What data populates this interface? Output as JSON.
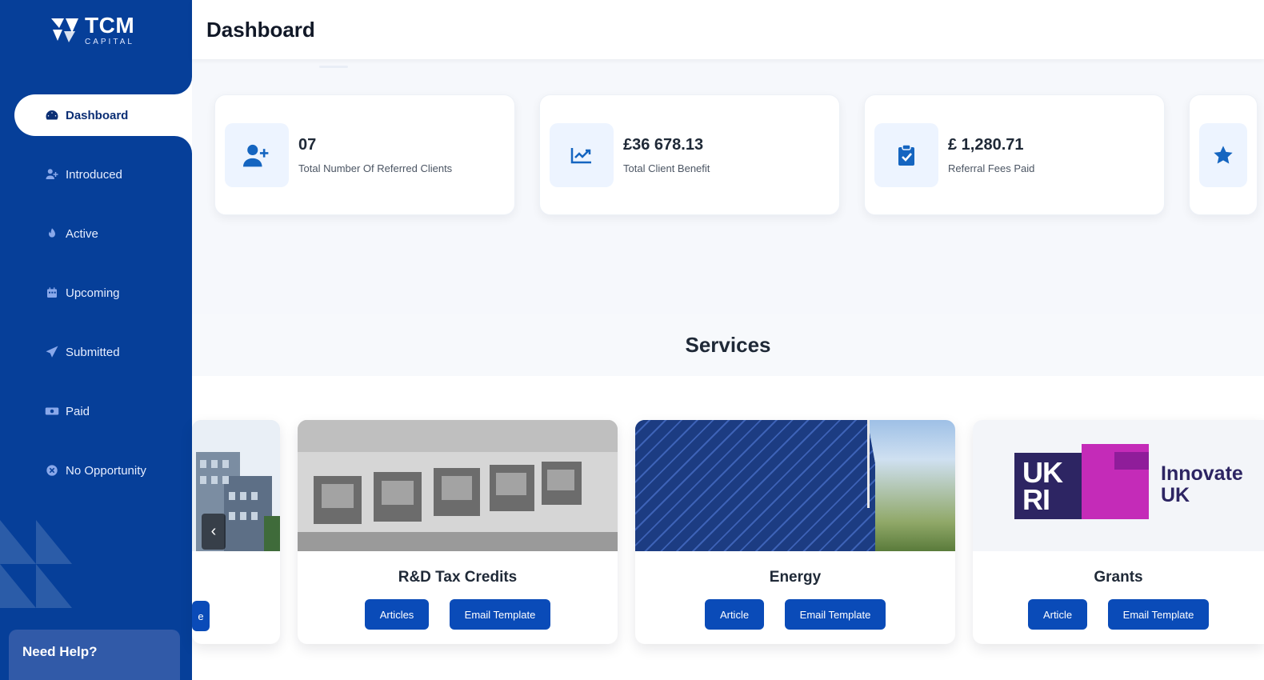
{
  "brand": {
    "name": "TCM",
    "sub": "CAPITAL"
  },
  "sidebar": {
    "items": [
      {
        "label": "Dashboard",
        "icon": "gauge-icon",
        "active": true
      },
      {
        "label": "Introduced",
        "icon": "user-plus-icon",
        "active": false
      },
      {
        "label": "Active",
        "icon": "flame-icon",
        "active": false
      },
      {
        "label": "Upcoming",
        "icon": "calendar-icon",
        "active": false
      },
      {
        "label": "Submitted",
        "icon": "paper-plane-icon",
        "active": false
      },
      {
        "label": "Paid",
        "icon": "money-icon",
        "active": false
      },
      {
        "label": "No Opportunity",
        "icon": "circle-x-icon",
        "active": false
      }
    ],
    "help": {
      "title": "Need Help?"
    }
  },
  "header": {
    "title": "Dashboard"
  },
  "stats": [
    {
      "value": "07",
      "label": "Total Number Of Referred Clients",
      "icon": "user-plus-icon"
    },
    {
      "value": "£36 678.13",
      "label": "Total Client Benefit",
      "icon": "chart-line-icon"
    },
    {
      "value": "£ 1,280.71",
      "label": "Referral Fees Paid",
      "icon": "clipboard-check-icon"
    },
    {
      "value": "",
      "label": "",
      "icon": "star-icon"
    }
  ],
  "services": {
    "title": "Services",
    "cards": [
      {
        "name": "R&D Tax Credits",
        "buttons": [
          "Articles",
          "Email Template"
        ]
      },
      {
        "name": "Energy",
        "buttons": [
          "Article",
          "Email Template"
        ]
      },
      {
        "name": "Grants",
        "buttons": [
          "Article",
          "Email Template"
        ]
      }
    ],
    "partial_button": "e"
  },
  "grants_logo": {
    "ukri_line1": "UK",
    "ukri_line2": "RI",
    "innovate_line1": "Innovate",
    "innovate_line2": "UK"
  },
  "controls": {
    "prev_arrow": "‹"
  },
  "colors": {
    "sidebar": "#063f99",
    "primary_button": "#0a4bb8",
    "icon_blue": "#1565c0"
  }
}
